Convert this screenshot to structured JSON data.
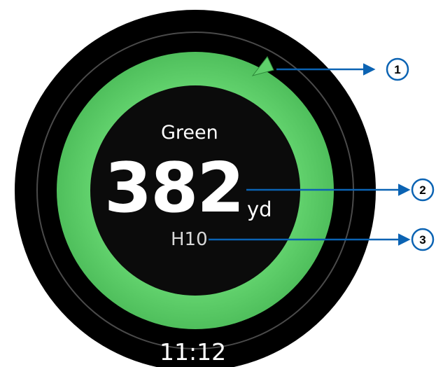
{
  "screen": {
    "title": "Green",
    "distance_value": "382",
    "distance_unit": "yd",
    "hole_label": "H10",
    "time": "11:12"
  },
  "indicators": {
    "green_pointer_icon": "green-direction-pointer-icon"
  },
  "callouts": [
    {
      "number": "1"
    },
    {
      "number": "2"
    },
    {
      "number": "3"
    }
  ],
  "colors": {
    "bezel": "#000000",
    "face_background": "#0b0b0b",
    "ring_green": "#5fcf6b",
    "text_primary": "#ffffff",
    "callout_blue": "#0b63b3",
    "callout_text": "#111111"
  }
}
